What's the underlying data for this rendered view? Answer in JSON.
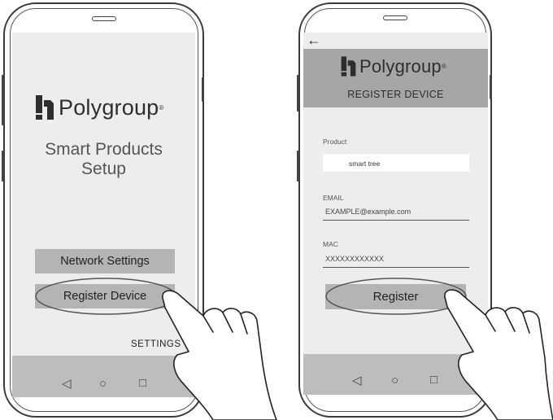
{
  "left_screen": {
    "brand": "Polygroup",
    "brand_mark": "®",
    "title_lines": [
      "Smart Products",
      "Setup"
    ],
    "buttons": [
      "Network Settings",
      "Register Device"
    ],
    "settings_label": "SETTINGS"
  },
  "right_screen": {
    "back_glyph": "←",
    "brand": "Polygroup",
    "brand_mark": "®",
    "subtitle": "REGISTER DEVICE",
    "product": {
      "label": "Product",
      "value": "smart tree"
    },
    "email": {
      "label": "EMAIL",
      "value": "EXAMPLE@example.com"
    },
    "mac": {
      "label": "MAC",
      "value": "XXXXXXXXXXXX"
    },
    "register_label": "Register"
  },
  "navbar": {
    "back_icon": "◁",
    "home_icon": "○",
    "recents_icon": "□"
  },
  "colors": {
    "screen_bg": "#ededed",
    "button_bg": "#b4b4b4",
    "header_bg": "#a6a6a6",
    "navbar_bg": "#bdbdbd"
  }
}
